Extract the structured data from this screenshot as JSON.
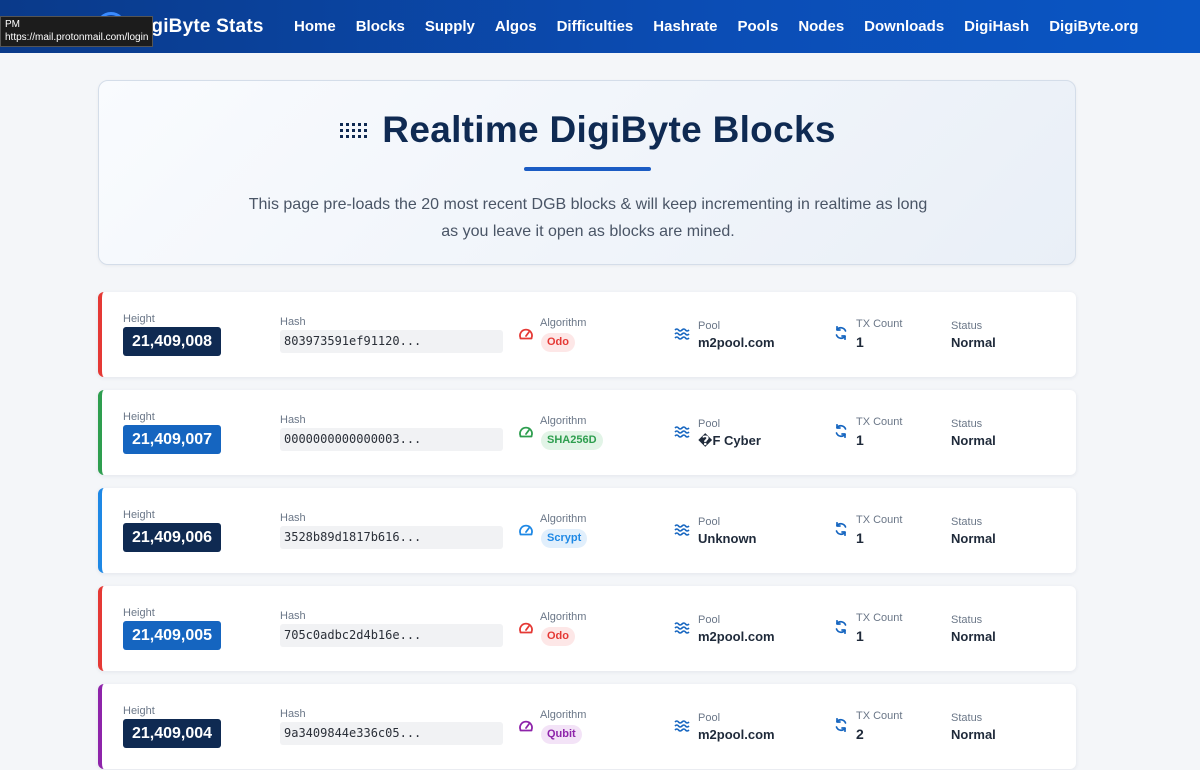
{
  "browser": {
    "tooltip_line1": "PM",
    "tooltip_line2": "https://mail.protonmail.com/login"
  },
  "brand": {
    "title": "DigiByte Stats"
  },
  "nav": {
    "items": [
      "Home",
      "Blocks",
      "Supply",
      "Algos",
      "Difficulties",
      "Hashrate",
      "Pools",
      "Nodes",
      "Downloads",
      "DigiHash",
      "DigiByte.org"
    ]
  },
  "hero": {
    "title": "Realtime DigiByte Blocks",
    "description": "This page pre-loads the 20 most recent DGB blocks & will keep incrementing in realtime as long as you leave it open as blocks are mined."
  },
  "labels": {
    "height": "Height",
    "hash": "Hash",
    "algorithm": "Algorithm",
    "pool": "Pool",
    "tx_count": "TX Count",
    "status": "Status"
  },
  "colors": {
    "odo": "#e53935",
    "sha256d": "#2e9e4f",
    "scrypt": "#1e88e5",
    "qubit": "#8e24aa",
    "badge_dark": "#0f2a52",
    "badge_blue": "#1565c0"
  },
  "blocks": [
    {
      "height": "21,409,008",
      "hash": "803973591ef91120...",
      "algorithm": "Odo",
      "pool": "m2pool.com",
      "tx_count": "1",
      "status": "Normal"
    },
    {
      "height": "21,409,007",
      "hash": "0000000000000003...",
      "algorithm": "SHA256D",
      "pool": "�F Cyber",
      "tx_count": "1",
      "status": "Normal"
    },
    {
      "height": "21,409,006",
      "hash": "3528b89d1817b616...",
      "algorithm": "Scrypt",
      "pool": "Unknown",
      "tx_count": "1",
      "status": "Normal"
    },
    {
      "height": "21,409,005",
      "hash": "705c0adbc2d4b16e...",
      "algorithm": "Odo",
      "pool": "m2pool.com",
      "tx_count": "1",
      "status": "Normal"
    },
    {
      "height": "21,409,004",
      "hash": "9a3409844e336c05...",
      "algorithm": "Qubit",
      "pool": "m2pool.com",
      "tx_count": "2",
      "status": "Normal"
    }
  ]
}
